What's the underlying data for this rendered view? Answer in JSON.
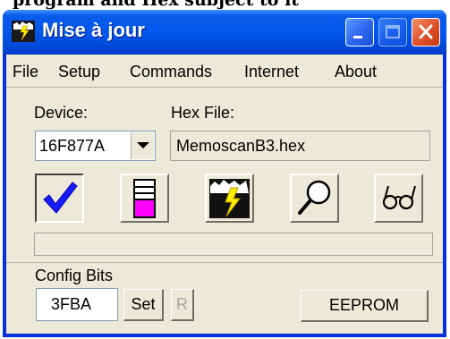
{
  "page_caption": "program and Hex subject to it",
  "window": {
    "title": "Mise à jour",
    "icon": "lightning-chip-icon"
  },
  "titlebar_buttons": {
    "minimize": "minimize-icon",
    "maximize": "maximize-icon",
    "close": "close-icon"
  },
  "menu": [
    "File",
    "Setup",
    "Commands",
    "Internet",
    "About"
  ],
  "device": {
    "label": "Device:",
    "value": "16F877A"
  },
  "hex_file": {
    "label": "Hex File:",
    "value": "MemoscanB3.hex"
  },
  "toolbar": [
    {
      "icon": "checkmark-icon",
      "pressed": true
    },
    {
      "icon": "chip-fill-icon",
      "pressed": false
    },
    {
      "icon": "lightning-chip-icon",
      "pressed": false
    },
    {
      "icon": "magnifier-icon",
      "pressed": false
    },
    {
      "icon": "glasses-icon",
      "pressed": false
    }
  ],
  "progress": 0,
  "config": {
    "label": "Config Bits",
    "value": "3FBA",
    "set_label": "Set",
    "r_label": "R"
  },
  "eeprom_label": "EEPROM",
  "colors": {
    "titlebar": "#0058ee",
    "face": "#ece9d8",
    "check": "#1a1aff",
    "fill": "#ff00ff",
    "lightning": "#ffee00"
  }
}
